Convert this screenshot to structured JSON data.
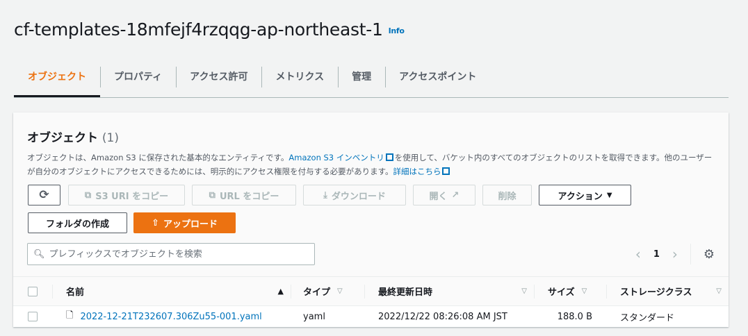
{
  "header": {
    "title": "cf-templates-18mfejf4rzqqg-ap-northeast-1",
    "info": "Info"
  },
  "tabs": [
    "オブジェクト",
    "プロパティ",
    "アクセス許可",
    "メトリクス",
    "管理",
    "アクセスポイント"
  ],
  "panel": {
    "title": "オブジェクト",
    "count": "(1)",
    "desc1": "オブジェクトは、Amazon S3 に保存された基本的なエンティティです。",
    "desc_link1": "Amazon S3 インベントリ",
    "desc2": "を使用して、バケット内のすべてのオブジェクトのリストを取得できます。他のユーザーが自分のオブジェクトにアクセスできるためには、明示的にアクセス権限を付与する必要があります。",
    "desc_link2": "詳細はこちら"
  },
  "toolbar": {
    "copy_s3_uri": "S3 URI をコピー",
    "copy_url": "URL をコピー",
    "download": "ダウンロード",
    "open": "開く",
    "delete": "削除",
    "actions": "アクション",
    "create_folder": "フォルダの作成",
    "upload": "アップロード"
  },
  "search": {
    "placeholder": "プレフィックスでオブジェクトを検索"
  },
  "pagination": {
    "page": "1"
  },
  "table": {
    "columns": [
      "名前",
      "タイプ",
      "最終更新日時",
      "サイズ",
      "ストレージクラス"
    ],
    "rows": [
      {
        "name": "2022-12-21T232607.306Zu55-001.yaml",
        "type": "yaml",
        "modified": "2022/12/22 08:26:08 AM JST",
        "size": "188.0 B",
        "storage": "スタンダード"
      }
    ]
  }
}
